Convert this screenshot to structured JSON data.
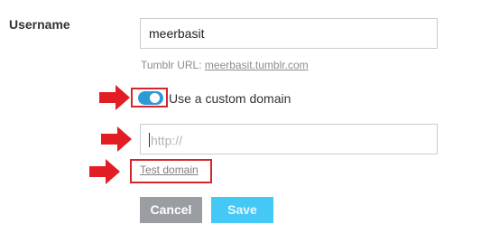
{
  "form": {
    "username_label": "Username",
    "username_value": "meerbasit",
    "tumblr_url_prefix": "Tumblr URL: ",
    "tumblr_url_link": "meerbasit.tumblr.com",
    "custom_domain_label": "Use a custom domain",
    "custom_domain_enabled": true,
    "domain_placeholder": "http://",
    "test_domain_label": "Test domain",
    "cancel_label": "Cancel",
    "save_label": "Save"
  },
  "colors": {
    "toggle_on": "#2d9ad6",
    "highlight_red": "#d6262d",
    "save_button": "#44c8f5",
    "cancel_button": "#9a9ea3"
  },
  "annotations": {
    "arrow_icon": "red-arrow-right-icon"
  }
}
